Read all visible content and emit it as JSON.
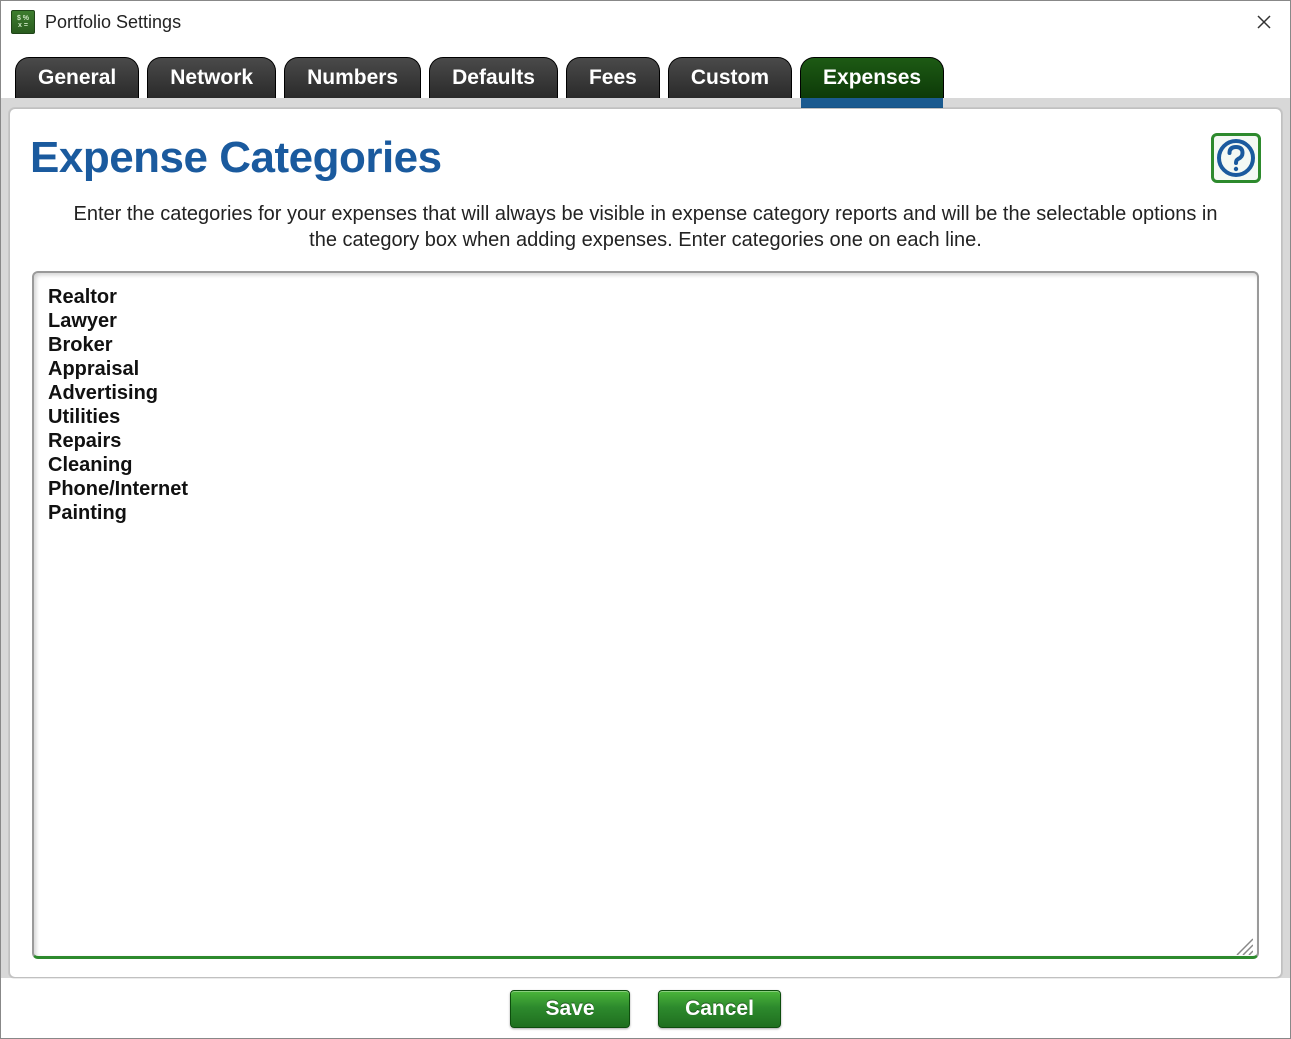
{
  "window": {
    "title": "Portfolio Settings"
  },
  "tabs": [
    {
      "label": "General",
      "active": false
    },
    {
      "label": "Network",
      "active": false
    },
    {
      "label": "Numbers",
      "active": false
    },
    {
      "label": "Defaults",
      "active": false
    },
    {
      "label": "Fees",
      "active": false
    },
    {
      "label": "Custom",
      "active": false
    },
    {
      "label": "Expenses",
      "active": true
    }
  ],
  "page": {
    "heading": "Expense Categories",
    "description": "Enter the categories for your expenses that will always be visible in expense category reports and will be the selectable options in the category box when adding expenses. Enter categories one on each line."
  },
  "categories_text": "Realtor\nLawyer\nBroker\nAppraisal\nAdvertising\nUtilities\nRepairs\nCleaning\nPhone/Internet\nPainting",
  "buttons": {
    "save": "Save",
    "cancel": "Cancel"
  }
}
